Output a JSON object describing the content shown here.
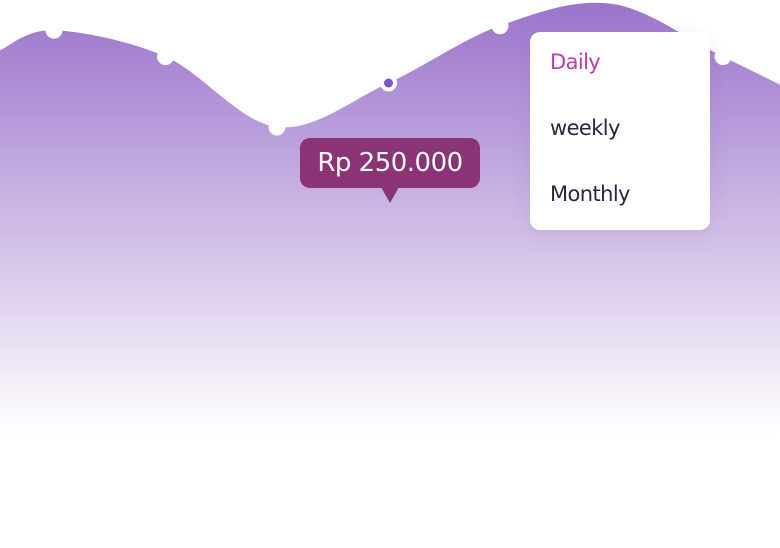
{
  "chart_data": {
    "type": "area",
    "x": [
      1,
      2,
      3,
      4,
      5,
      6,
      7,
      8
    ],
    "y": [
      0.92,
      0.86,
      0.7,
      0.8,
      0.93,
      0.98,
      0.86,
      0.73
    ],
    "point_visible": [
      true,
      true,
      true,
      true,
      true,
      false,
      true,
      true
    ],
    "highlighted_index": 3,
    "highlighted_value_label": "Rp 250.000",
    "title": "",
    "xlabel": "",
    "ylabel": "",
    "grid": false,
    "colors": {
      "fill_top": "#9b74cc",
      "fill_bottom": "#ffffff",
      "point_fill": "#ffffff",
      "highlight_dot": "#7b54d6"
    }
  },
  "tooltip": {
    "value": "Rp 250.000",
    "color": "#8a3476"
  },
  "period_menu": {
    "items": [
      {
        "label": "Daily",
        "selected": true
      },
      {
        "label": "weekly",
        "selected": false
      },
      {
        "label": "Monthly",
        "selected": false
      }
    ],
    "selected_color": "#c43aa2"
  }
}
